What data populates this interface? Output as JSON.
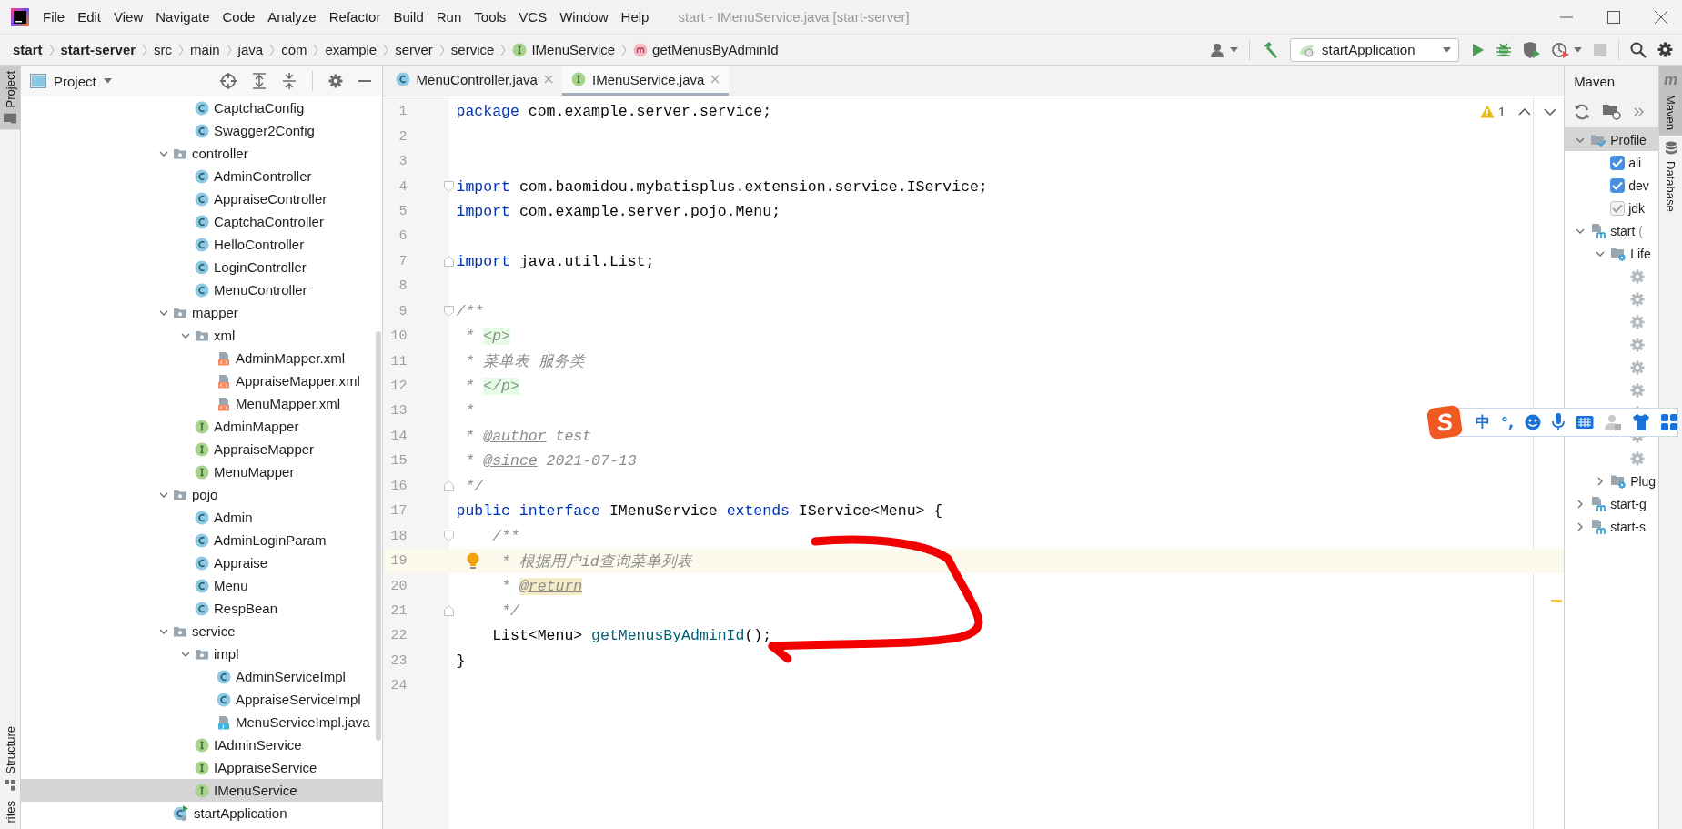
{
  "title_bar": {
    "menus": [
      "File",
      "Edit",
      "View",
      "Navigate",
      "Code",
      "Analyze",
      "Refactor",
      "Build",
      "Run",
      "Tools",
      "VCS",
      "Window",
      "Help"
    ],
    "title": "start - IMenuService.java [start-server]"
  },
  "breadcrumbs": [
    {
      "label": "start",
      "kind": "module"
    },
    {
      "label": "start-server",
      "kind": "module"
    },
    {
      "label": "src",
      "kind": "dir"
    },
    {
      "label": "main",
      "kind": "dir"
    },
    {
      "label": "java",
      "kind": "dir"
    },
    {
      "label": "com",
      "kind": "dir"
    },
    {
      "label": "example",
      "kind": "dir"
    },
    {
      "label": "server",
      "kind": "dir"
    },
    {
      "label": "service",
      "kind": "dir"
    },
    {
      "label": "IMenuService",
      "kind": "interface"
    },
    {
      "label": "getMenusByAdminId",
      "kind": "method"
    }
  ],
  "run_config": {
    "label": "startApplication"
  },
  "left_stripe": [
    {
      "label": "Project",
      "kind": "project",
      "selected": true
    },
    {
      "label": "Structure",
      "kind": "structure",
      "selected": false
    },
    {
      "label": "rites",
      "kind": "favorites",
      "selected": false
    }
  ],
  "project_panel": {
    "title": "Project",
    "tree": [
      {
        "children": [
          {
            "label": "CaptchaConfig",
            "kind": "class",
            "selected": false
          },
          {
            "label": "Swagger2Config",
            "kind": "class",
            "selected": false
          }
        ]
      },
      {
        "label": "controller",
        "kind": "package",
        "expanded": true,
        "selected": false,
        "children": [
          {
            "label": "AdminController",
            "kind": "class",
            "selected": false
          },
          {
            "label": "AppraiseController",
            "kind": "class",
            "selected": false
          },
          {
            "label": "CaptchaController",
            "kind": "class",
            "selected": false
          },
          {
            "label": "HelloController",
            "kind": "class",
            "selected": false
          },
          {
            "label": "LoginController",
            "kind": "class",
            "selected": false
          },
          {
            "label": "MenuController",
            "kind": "class",
            "selected": false
          }
        ]
      },
      {
        "label": "mapper",
        "kind": "package",
        "expanded": true,
        "selected": false,
        "children": [
          {
            "label": "xml",
            "kind": "package",
            "expanded": true,
            "selected": false,
            "children": [
              {
                "label": "AdminMapper.xml",
                "kind": "xml",
                "selected": false
              },
              {
                "label": "AppraiseMapper.xml",
                "kind": "xml",
                "selected": false
              },
              {
                "label": "MenuMapper.xml",
                "kind": "xml",
                "selected": false
              }
            ]
          },
          {
            "label": "AdminMapper",
            "kind": "interface",
            "selected": false
          },
          {
            "label": "AppraiseMapper",
            "kind": "interface",
            "selected": false
          },
          {
            "label": "MenuMapper",
            "kind": "interface",
            "selected": false
          }
        ]
      },
      {
        "label": "pojo",
        "kind": "package",
        "expanded": true,
        "selected": false,
        "children": [
          {
            "label": "Admin",
            "kind": "class",
            "selected": false
          },
          {
            "label": "AdminLoginParam",
            "kind": "class",
            "selected": false
          },
          {
            "label": "Appraise",
            "kind": "class",
            "selected": false
          },
          {
            "label": "Menu",
            "kind": "class",
            "selected": false
          },
          {
            "label": "RespBean",
            "kind": "class",
            "selected": false
          }
        ]
      },
      {
        "label": "service",
        "kind": "package",
        "expanded": true,
        "selected": false,
        "children": [
          {
            "label": "impl",
            "kind": "package",
            "expanded": true,
            "selected": false,
            "children": [
              {
                "label": "AdminServiceImpl",
                "kind": "class",
                "selected": false
              },
              {
                "label": "AppraiseServiceImpl",
                "kind": "class",
                "selected": false
              },
              {
                "label": "MenuServiceImpl.java",
                "kind": "java-file",
                "selected": false
              }
            ]
          },
          {
            "label": "IAdminService",
            "kind": "interface",
            "selected": false
          },
          {
            "label": "IAppraiseService",
            "kind": "interface",
            "selected": false
          },
          {
            "label": "IMenuService",
            "kind": "interface",
            "selected": true
          }
        ]
      },
      {
        "label": "startApplication",
        "kind": "spring-app",
        "selected": false
      }
    ]
  },
  "editor": {
    "tabs": [
      {
        "label": "MenuController.java",
        "kind": "class",
        "selected": false
      },
      {
        "label": "IMenuService.java",
        "kind": "interface",
        "selected": true
      }
    ],
    "warnings": "1",
    "lines": [
      {
        "number": "1",
        "current": false,
        "tokens": [
          {
            "kind": "keyword",
            "text": "package"
          },
          {
            "kind": "plain",
            "text": " com.example.server.service;"
          }
        ]
      },
      {
        "number": "2",
        "current": false
      },
      {
        "number": "3",
        "current": false
      },
      {
        "number": "4",
        "current": false,
        "fold_open": true,
        "tokens": [
          {
            "kind": "keyword",
            "text": "import"
          },
          {
            "kind": "plain",
            "text": " com.baomidou.mybatisplus.extension.service.IService;"
          }
        ]
      },
      {
        "number": "5",
        "current": false,
        "tokens": [
          {
            "kind": "keyword",
            "text": "import"
          },
          {
            "kind": "plain",
            "text": " com.example.server.pojo.Menu;"
          }
        ]
      },
      {
        "number": "6",
        "current": false
      },
      {
        "number": "7",
        "current": false,
        "fold_close": true,
        "tokens": [
          {
            "kind": "keyword",
            "text": "import"
          },
          {
            "kind": "plain",
            "text": " java.util.List;"
          }
        ]
      },
      {
        "number": "8",
        "current": false
      },
      {
        "number": "9",
        "current": false,
        "fold_open": true,
        "tokens": [
          {
            "kind": "comment",
            "text": "/**"
          }
        ]
      },
      {
        "number": "10",
        "current": false,
        "tokens": [
          {
            "kind": "comment",
            "text": " * "
          },
          {
            "kind": "tag",
            "text": "<p>"
          }
        ]
      },
      {
        "number": "11",
        "current": false,
        "tokens": [
          {
            "kind": "comment",
            "text": " * 菜单表 服务类"
          }
        ]
      },
      {
        "number": "12",
        "current": false,
        "tokens": [
          {
            "kind": "comment",
            "text": " * "
          },
          {
            "kind": "tag",
            "text": "</p>"
          }
        ]
      },
      {
        "number": "13",
        "current": false,
        "tokens": [
          {
            "kind": "comment",
            "text": " *"
          }
        ]
      },
      {
        "number": "14",
        "current": false,
        "tokens": [
          {
            "kind": "comment",
            "text": " * "
          },
          {
            "kind": "doc-tag",
            "text": "@author"
          },
          {
            "kind": "comment",
            "text": " test"
          }
        ]
      },
      {
        "number": "15",
        "current": false,
        "tokens": [
          {
            "kind": "comment",
            "text": " * "
          },
          {
            "kind": "doc-tag",
            "text": "@since"
          },
          {
            "kind": "comment",
            "text": " 2021-07-13"
          }
        ]
      },
      {
        "number": "16",
        "current": false,
        "fold_close": true,
        "tokens": [
          {
            "kind": "comment",
            "text": " */"
          }
        ]
      },
      {
        "number": "17",
        "current": false,
        "tokens": [
          {
            "kind": "keyword",
            "text": "public interface"
          },
          {
            "kind": "plain",
            "text": " IMenuService "
          },
          {
            "kind": "keyword",
            "text": "extends"
          },
          {
            "kind": "plain",
            "text": " IService<Menu> {"
          }
        ]
      },
      {
        "number": "18",
        "current": false,
        "fold_open": true,
        "tokens": [
          {
            "kind": "comment",
            "text": "    /**"
          }
        ]
      },
      {
        "number": "19",
        "current": true,
        "tokens": [
          {
            "kind": "comment",
            "text": "     * 根据用户id查询菜单列表"
          }
        ]
      },
      {
        "number": "20",
        "current": false,
        "tokens": [
          {
            "kind": "comment",
            "text": "     * "
          },
          {
            "kind": "doc-tag-hl",
            "text": "@return"
          }
        ]
      },
      {
        "number": "21",
        "current": false,
        "fold_close": true,
        "tokens": [
          {
            "kind": "comment",
            "text": "     */"
          }
        ]
      },
      {
        "number": "22",
        "current": false,
        "tokens": [
          {
            "kind": "plain",
            "text": "    List<Menu> "
          },
          {
            "kind": "method",
            "text": "getMenusByAdminId"
          },
          {
            "kind": "plain",
            "text": "();"
          }
        ]
      },
      {
        "number": "23",
        "current": false,
        "tokens": [
          {
            "kind": "plain",
            "text": "}"
          }
        ]
      },
      {
        "number": "24",
        "current": false
      }
    ]
  },
  "maven_panel": {
    "title": "Maven",
    "tree": [
      {
        "label": "Profile",
        "kind": "profiles",
        "expanded": true,
        "selected": true,
        "children": [
          {
            "label": "ali",
            "kind": "profile",
            "checked": true,
            "disabled": false,
            "selected": false
          },
          {
            "label": "dev",
            "kind": "profile",
            "checked": true,
            "disabled": false,
            "selected": false
          },
          {
            "label": "jdk",
            "kind": "profile",
            "checked": true,
            "disabled": true,
            "selected": false
          }
        ]
      },
      {
        "label": "start",
        "suffix": "(",
        "kind": "module",
        "expanded": true,
        "selected": false,
        "children": [
          {
            "label": "Life",
            "kind": "lifecycle",
            "expanded": true,
            "selected": false,
            "children": [
              {
                "kind": "goal",
                "selected": false
              },
              {
                "kind": "goal",
                "selected": false
              },
              {
                "kind": "goal",
                "selected": false
              },
              {
                "kind": "goal",
                "selected": false
              },
              {
                "kind": "goal",
                "selected": false
              },
              {
                "kind": "goal",
                "selected": false
              },
              {
                "kind": "goal",
                "selected": false
              },
              {
                "kind": "goal",
                "selected": false
              },
              {
                "kind": "goal",
                "selected": false
              }
            ]
          },
          {
            "label": "Plug",
            "kind": "plugins",
            "expanded": false,
            "selected": false
          }
        ]
      },
      {
        "label": "start-g",
        "kind": "module",
        "expanded": false,
        "selected": false
      },
      {
        "label": "start-s",
        "kind": "module",
        "expanded": false,
        "selected": false
      }
    ]
  },
  "right_stripe": [
    {
      "label": "Maven",
      "glyph": "m",
      "kind": "maven",
      "selected": true
    },
    {
      "label": "Database",
      "kind": "database",
      "selected": false
    }
  ],
  "ime_toolbar": {
    "logo": "S",
    "mode": "中",
    "punctuation": "°,"
  }
}
